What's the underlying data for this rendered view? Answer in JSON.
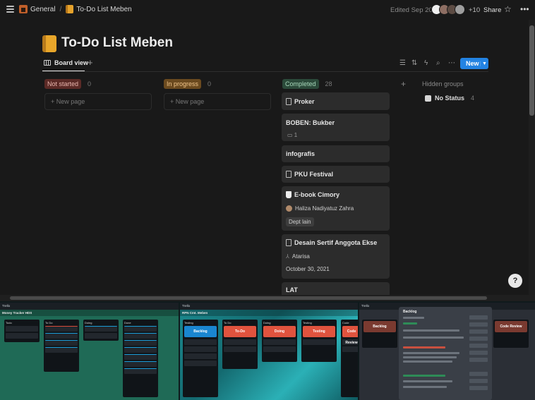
{
  "topbar": {
    "crumb_general": "General",
    "crumb_page": "To-Do List Meben",
    "edited": "Edited Sep 20",
    "extra_collaborators": "+10",
    "share": "Share"
  },
  "page": {
    "title": "To-Do List Meben",
    "view_tab": "Board view"
  },
  "toolbar": {
    "new_label": "New"
  },
  "groups": [
    {
      "label": "Not started",
      "count": "0",
      "new_page": "+ New page",
      "color": "#5b2a26"
    },
    {
      "label": "In progress",
      "count": "0",
      "new_page": "+ New page",
      "color": "#6b4a1f"
    },
    {
      "label": "Completed",
      "count": "28",
      "color": "#2b4a3a"
    }
  ],
  "hidden": {
    "label": "Hidden groups",
    "no_status": "No Status",
    "no_status_count": "4"
  },
  "cards": {
    "c1": {
      "title": "Proker"
    },
    "c2": {
      "title": "BOBEN: Bukber",
      "comments": "1"
    },
    "c3": {
      "title": "infografis"
    },
    "c4": {
      "title": "PKU Festival"
    },
    "c5": {
      "title": "E-book Cimory",
      "person": "Haliza Nadiyatuz Zahra",
      "tag": "Dept lain"
    },
    "c6": {
      "title": "Desain Sertif Anggota Ekse",
      "person": "Atarisa",
      "date": "October 30, 2021"
    },
    "c7": {
      "title": "LAT"
    }
  },
  "thumbnails": {
    "t1": {
      "app": "Trello",
      "board": "Money Tracker HDS",
      "lists": [
        "Todo",
        "To Do",
        "Doing",
        "Done"
      ]
    },
    "t2": {
      "app": "Trello",
      "board": "RPN Cmt. Meben",
      "lists": [
        "Backlog",
        "To-Do",
        "Doing",
        "Testing",
        "Code Review"
      ]
    },
    "t3": {
      "app": "Trello",
      "modal_title": "Backlog"
    }
  }
}
